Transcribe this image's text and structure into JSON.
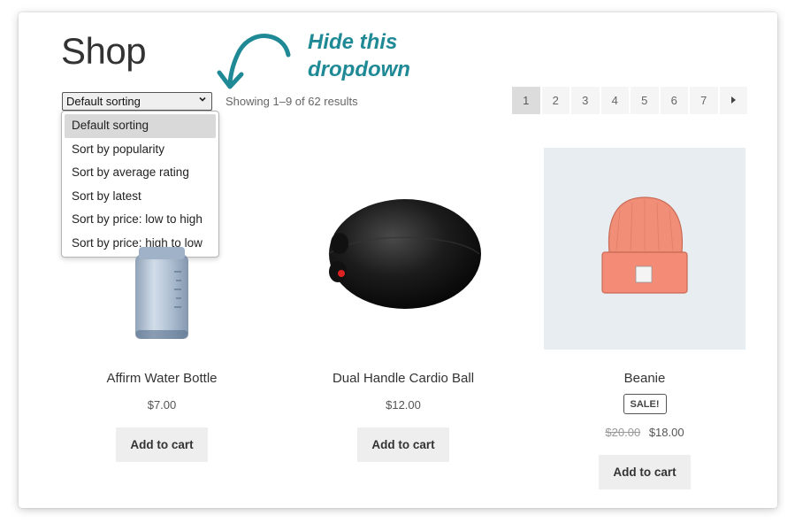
{
  "page": {
    "title": "Shop"
  },
  "annotation": {
    "line1": "Hide this",
    "line2": "dropdown",
    "color": "#1f8a96"
  },
  "sorting": {
    "selected_label": "Default sorting",
    "options": [
      "Default sorting",
      "Sort by popularity",
      "Sort by average rating",
      "Sort by latest",
      "Sort by price: low to high",
      "Sort by price: high to low"
    ]
  },
  "results": {
    "count_text": "Showing 1–9 of 62 results"
  },
  "pagination": {
    "pages": [
      "1",
      "2",
      "3",
      "4",
      "5",
      "6",
      "7"
    ],
    "current": "1",
    "next_icon": "caret-right-icon"
  },
  "products": [
    {
      "name": "Affirm Water Bottle",
      "price": "$7.00",
      "button": "Add to cart",
      "image_icon": "water-bottle-image"
    },
    {
      "name": "Dual Handle Cardio Ball",
      "price": "$12.00",
      "button": "Add to cart",
      "image_icon": "cardio-ball-image"
    },
    {
      "name": "Beanie",
      "badge": "SALE!",
      "old_price": "$20.00",
      "price": "$18.00",
      "button": "Add to cart",
      "image_icon": "beanie-image"
    }
  ]
}
